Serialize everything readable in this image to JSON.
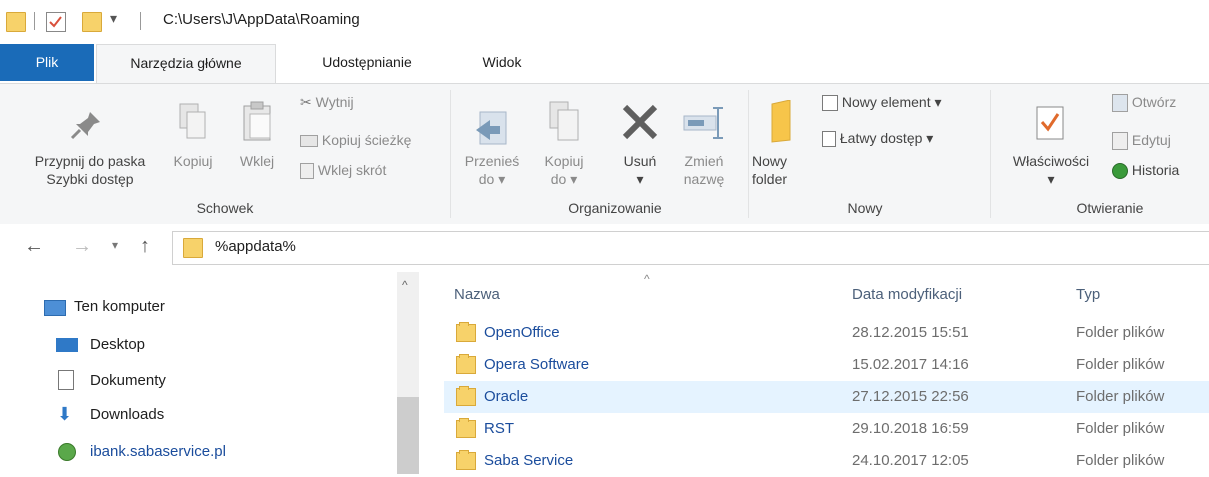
{
  "titlebar": {
    "path": "C:\\Users\\J\\AppData\\Roaming",
    "dropdown_glyph": "▾"
  },
  "tabs": [
    {
      "label": "Plik"
    },
    {
      "label": "Narzędzia główne"
    },
    {
      "label": "Udostępnianie"
    },
    {
      "label": "Widok"
    }
  ],
  "ribbon": {
    "clipboard": {
      "pin_label_1": "Przypnij do paska",
      "pin_label_2": "Szybki dostęp",
      "copy": "Kopiuj",
      "paste": "Wklej",
      "cut": "Wytnij",
      "copy_path": "Kopiuj ścieżkę",
      "paste_shortcut": "Wklej skrót",
      "group": "Schowek"
    },
    "organize": {
      "move_1": "Przenieś",
      "move_2": "do",
      "copy_1": "Kopiuj",
      "copy_2": "do",
      "delete": "Usuń",
      "rename_1": "Zmień",
      "rename_2": "nazwę",
      "group": "Organizowanie"
    },
    "new": {
      "new_folder_1": "Nowy",
      "new_folder_2": "folder",
      "new_item": "Nowy element",
      "easy_access": "Łatwy dostęp",
      "group": "Nowy"
    },
    "open": {
      "properties": "Właściwości",
      "open": "Otwórz",
      "edit": "Edytuj",
      "history": "Historia",
      "group": "Otwieranie"
    }
  },
  "address": {
    "value": "%appdata%"
  },
  "navpane": {
    "items": [
      {
        "label": "Ten komputer"
      },
      {
        "label": "Desktop"
      },
      {
        "label": "Dokumenty"
      },
      {
        "label": "Downloads"
      },
      {
        "label": "ibank.sabaservice.pl"
      }
    ]
  },
  "filelist": {
    "headers": {
      "name": "Nazwa",
      "date": "Data modyfikacji",
      "type": "Typ"
    },
    "rows": [
      {
        "name": "OpenOffice",
        "date": "28.12.2015 15:51",
        "type": "Folder plików"
      },
      {
        "name": "Opera Software",
        "date": "15.02.2017 14:16",
        "type": "Folder plików"
      },
      {
        "name": "Oracle",
        "date": "27.12.2015 22:56",
        "type": "Folder plików"
      },
      {
        "name": "RST",
        "date": "29.10.2018 16:59",
        "type": "Folder plików"
      },
      {
        "name": "Saba Service",
        "date": "24.10.2017 12:05",
        "type": "Folder plików"
      }
    ]
  },
  "colors": {
    "accent": "#1a6bb8",
    "selected_row": "#e5f3ff",
    "folder": "#f7d26a"
  }
}
